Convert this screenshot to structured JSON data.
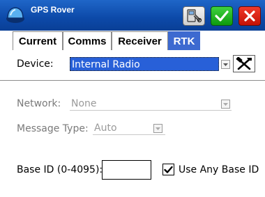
{
  "titlebar": {
    "app_title": "GPS Rover"
  },
  "tabs": [
    {
      "label": "Current",
      "selected": false
    },
    {
      "label": "Comms",
      "selected": false
    },
    {
      "label": "Receiver",
      "selected": false
    },
    {
      "label": "RTK",
      "selected": true
    }
  ],
  "form": {
    "device": {
      "label": "Device:",
      "value": "Internal Radio",
      "enabled": true
    },
    "network": {
      "label": "Network:",
      "value": "None",
      "enabled": false
    },
    "message_type": {
      "label": "Message Type:",
      "value": "Auto",
      "enabled": false
    },
    "base_id": {
      "label": "Base ID (0-4095):",
      "value": ""
    },
    "use_any_base_id": {
      "label": "Use Any Base ID",
      "checked": true
    }
  },
  "icons": {
    "app": "gps-receiver-icon",
    "tool": "receiver-tool-icon",
    "ok": "checkmark-icon",
    "close": "close-icon",
    "settings": "tools-icon"
  },
  "colors": {
    "titlebar": "#0c49a8",
    "selected_tab": "#3d6ad0",
    "selection_highlight": "#2860d8",
    "ok_button": "#1fb51f",
    "close_button": "#dd2417"
  }
}
